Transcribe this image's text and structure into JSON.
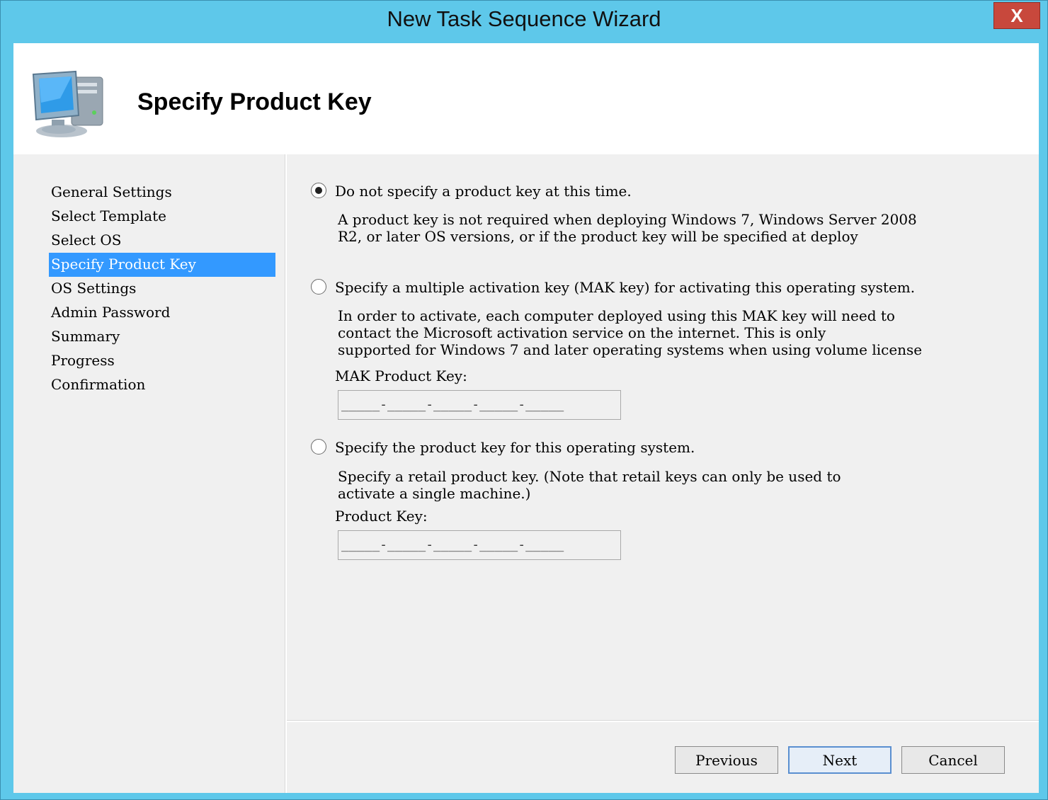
{
  "window": {
    "title": "New Task Sequence Wizard",
    "close_glyph": "X"
  },
  "header": {
    "title": "Specify Product Key",
    "icon": "computer-icon"
  },
  "nav": {
    "items": [
      {
        "label": "General Settings",
        "selected": false
      },
      {
        "label": "Select Template",
        "selected": false
      },
      {
        "label": "Select OS",
        "selected": false
      },
      {
        "label": "Specify Product Key",
        "selected": true
      },
      {
        "label": "OS Settings",
        "selected": false
      },
      {
        "label": "Admin Password",
        "selected": false
      },
      {
        "label": "Summary",
        "selected": false
      },
      {
        "label": "Progress",
        "selected": false
      },
      {
        "label": "Confirmation",
        "selected": false
      }
    ]
  },
  "options": {
    "none": {
      "label": "Do not specify a product key at this time.",
      "checked": true,
      "desc": [
        "A product key is not required when deploying Windows 7, Windows Server 2008",
        "R2, or later OS versions, or if the product key will be specified at deploy"
      ]
    },
    "mak": {
      "label": "Specify a multiple activation key (MAK key) for activating this operating system.",
      "checked": false,
      "desc": [
        "In order to activate, each computer deployed using this MAK key will need to",
        "contact the Microsoft activation service on the internet.  This is only",
        "supported for Windows 7 and later operating systems when using volume license"
      ],
      "field_label": "MAK Product Key:",
      "field_mask": "_____-_____-_____-_____-_____"
    },
    "retail": {
      "label": "Specify the product key for this operating system.",
      "checked": false,
      "desc": [
        "Specify a retail product key.  (Note that retail keys can only be used to",
        "activate a single machine.)"
      ],
      "field_label": "Product Key:",
      "field_mask": "_____-_____-_____-_____-_____"
    }
  },
  "buttons": {
    "previous": "Previous",
    "next": "Next",
    "cancel": "Cancel"
  },
  "colors": {
    "frame": "#5ec8ea",
    "selection": "#3399ff",
    "close": "#c8483c"
  }
}
